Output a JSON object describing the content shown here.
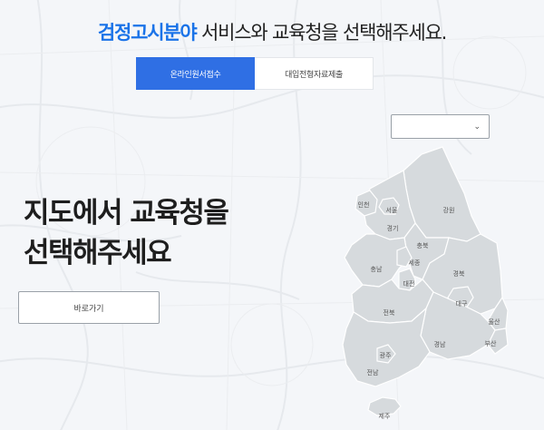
{
  "header": {
    "accent_text": "검정고시분야",
    "rest_text": " 서비스와 교육청을 선택해주세요."
  },
  "tabs": [
    {
      "label": "온라인원서접수",
      "active": true
    },
    {
      "label": "대입전형자료제출",
      "active": false
    }
  ],
  "region_select": {
    "value": "",
    "icon": "chevron-down-icon"
  },
  "intro": {
    "line1": "지도에서 교육청을",
    "line2": "선택해주세요"
  },
  "go_button": {
    "label": "바로가기"
  },
  "map": {
    "regions": [
      {
        "id": "incheon",
        "label": "인천"
      },
      {
        "id": "seoul",
        "label": "서울"
      },
      {
        "id": "gyeonggi",
        "label": "경기"
      },
      {
        "id": "gangwon",
        "label": "강원"
      },
      {
        "id": "chungbuk",
        "label": "충북"
      },
      {
        "id": "chungnam",
        "label": "충남"
      },
      {
        "id": "sejong",
        "label": "세종"
      },
      {
        "id": "daejeon",
        "label": "대전"
      },
      {
        "id": "gyeongbuk",
        "label": "경북"
      },
      {
        "id": "daegu",
        "label": "대구"
      },
      {
        "id": "jeonbuk",
        "label": "전북"
      },
      {
        "id": "ulsan",
        "label": "울산"
      },
      {
        "id": "gwangju",
        "label": "광주"
      },
      {
        "id": "gyeongnam",
        "label": "경남"
      },
      {
        "id": "busan",
        "label": "부산"
      },
      {
        "id": "jeonnam",
        "label": "전남"
      },
      {
        "id": "jeju",
        "label": "제주"
      }
    ]
  },
  "colors": {
    "accent": "#1a73e8",
    "tab_active": "#2f6fe4",
    "map_fill": "#d6dadd"
  }
}
